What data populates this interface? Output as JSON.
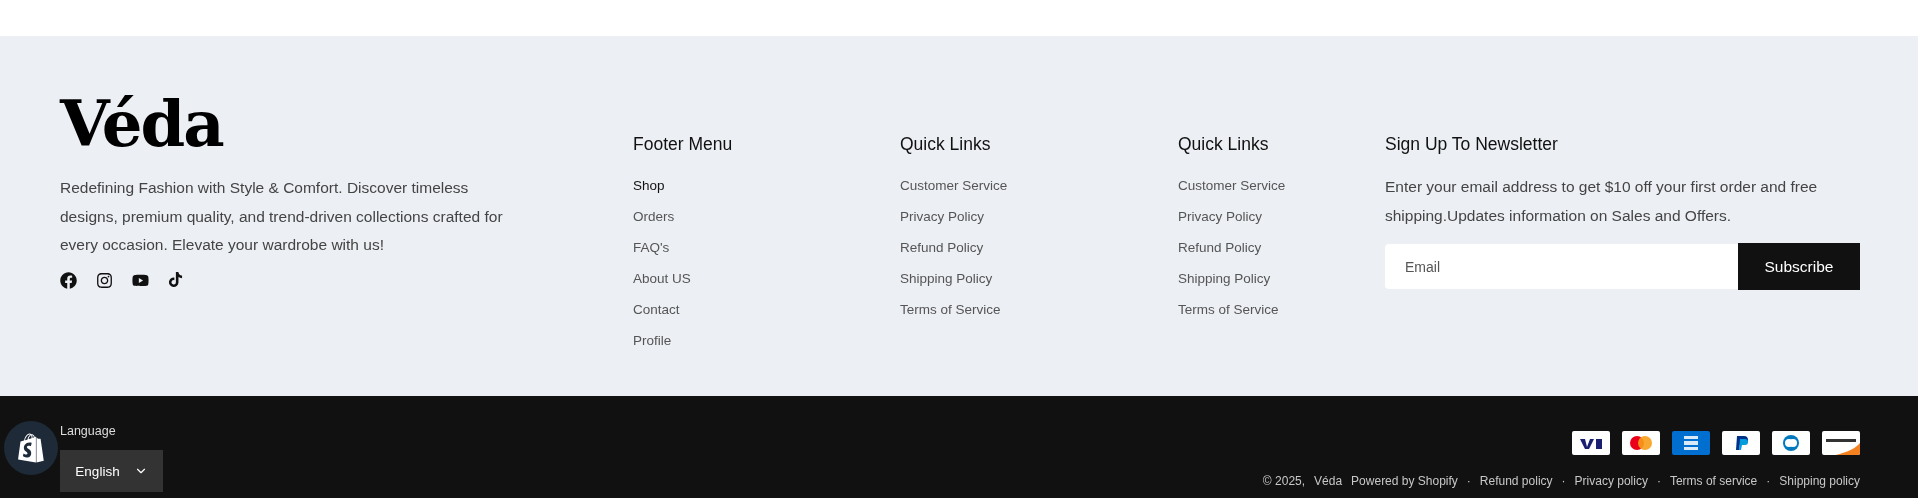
{
  "brand": {
    "logo": "Véda",
    "description": "Redefining Fashion with Style & Comfort. Discover timeless designs, premium quality, and trend-driven collections crafted for every occasion. Elevate your wardrobe with us!",
    "social": [
      {
        "kind": "facebook"
      },
      {
        "kind": "instagram"
      },
      {
        "kind": "youtube"
      },
      {
        "kind": "tiktok"
      }
    ]
  },
  "menus": [
    {
      "title": "Footer Menu",
      "items": [
        {
          "label": "Shop",
          "selected": true
        },
        {
          "label": "Orders",
          "selected": false
        },
        {
          "label": "FAQ's",
          "selected": false
        },
        {
          "label": "About US",
          "selected": false
        },
        {
          "label": "Contact",
          "selected": false
        },
        {
          "label": "Profile",
          "selected": false
        }
      ]
    },
    {
      "title": "Quick Links",
      "items": [
        {
          "label": "Customer Service",
          "selected": false
        },
        {
          "label": "Privacy Policy",
          "selected": false
        },
        {
          "label": "Refund Policy",
          "selected": false
        },
        {
          "label": "Shipping Policy",
          "selected": false
        },
        {
          "label": "Terms of Service",
          "selected": false
        }
      ]
    },
    {
      "title": "Quick Links",
      "items": [
        {
          "label": "Customer Service",
          "selected": false
        },
        {
          "label": "Privacy Policy",
          "selected": false
        },
        {
          "label": "Refund Policy",
          "selected": false
        },
        {
          "label": "Shipping Policy",
          "selected": false
        },
        {
          "label": "Terms of Service",
          "selected": false
        }
      ]
    }
  ],
  "newsletter": {
    "title": "Sign Up To Newsletter",
    "text": "Enter your email address to get $10 off your first order and free shipping.Updates information on Sales and Offers.",
    "placeholder": "Email",
    "button": "Subscribe"
  },
  "bottom_bar": {
    "language_label": "Language",
    "language": "English",
    "payment_methods": [
      {
        "kind": "visa"
      },
      {
        "kind": "mastercard"
      },
      {
        "kind": "amex"
      },
      {
        "kind": "paypal"
      },
      {
        "kind": "diners"
      },
      {
        "kind": "discover"
      }
    ],
    "copyright": "© 2025,",
    "store_link": "Véda",
    "powered_by": "Powered by Shopify",
    "separator": "·",
    "policies": [
      "Refund policy",
      "Privacy policy",
      "Terms of service",
      "Shipping policy"
    ]
  }
}
